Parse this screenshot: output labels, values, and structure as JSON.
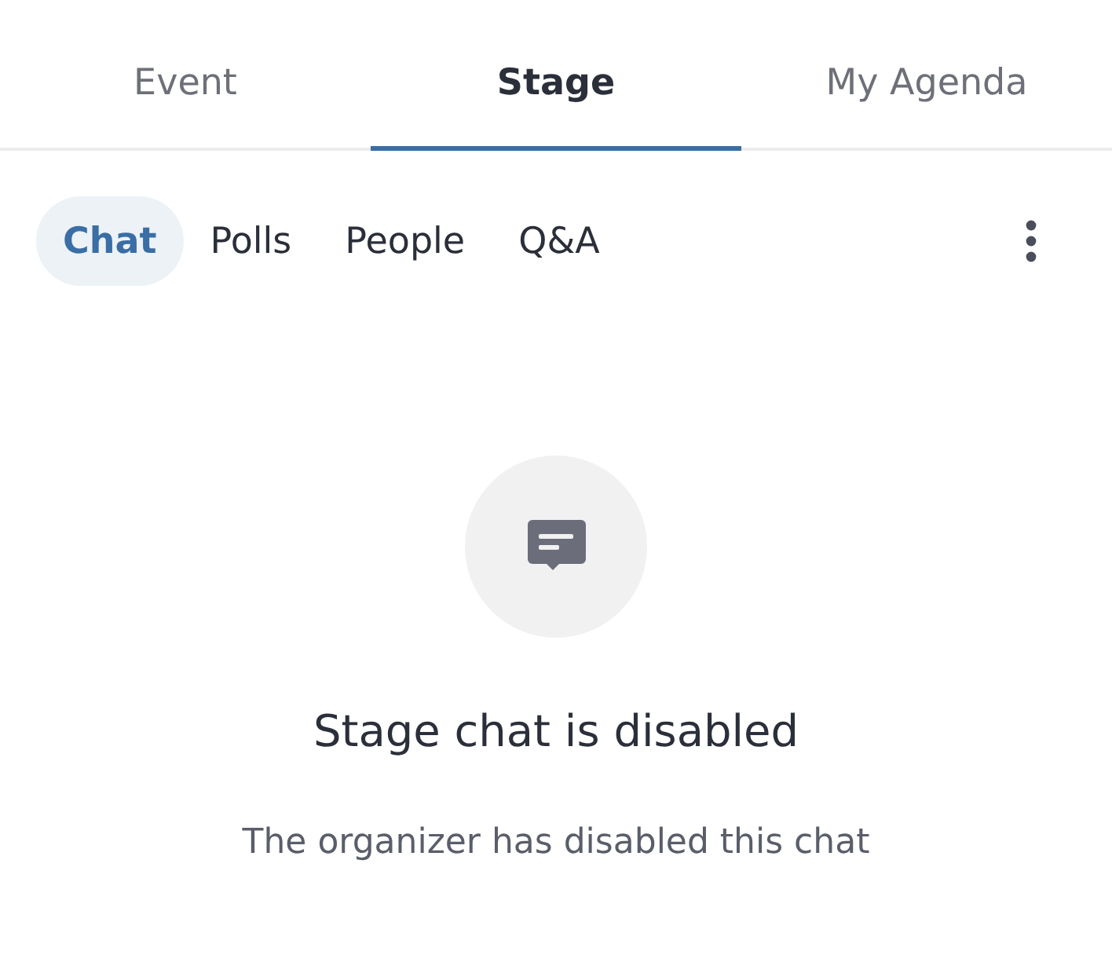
{
  "main_tabs": [
    {
      "label": "Event",
      "selected": false
    },
    {
      "label": "Stage",
      "selected": true
    },
    {
      "label": "My Agenda",
      "selected": false
    }
  ],
  "sub_tabs": [
    {
      "label": "Chat",
      "selected": true
    },
    {
      "label": "Polls",
      "selected": false
    },
    {
      "label": "People",
      "selected": false
    },
    {
      "label": "Q&A",
      "selected": false
    }
  ],
  "empty_state": {
    "title": "Stage chat is disabled",
    "message": "The organizer has disabled this chat"
  }
}
